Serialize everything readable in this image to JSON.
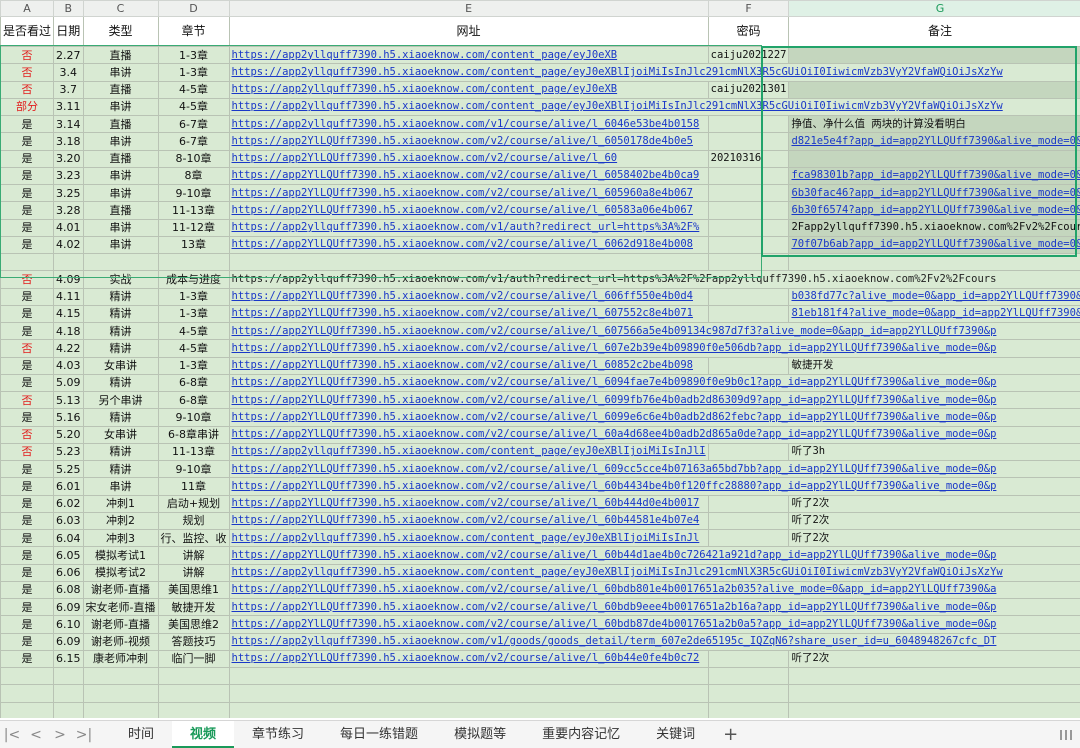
{
  "columns": [
    "A",
    "B",
    "C",
    "D",
    "E",
    "F",
    "G"
  ],
  "headers": [
    "是否看过",
    "日期",
    "类型",
    "章节",
    "网址",
    "密码",
    "备注"
  ],
  "rows": [
    [
      "否",
      "2.27",
      "直播",
      "1-3章",
      "https://app2yllquff7390.h5.xiaoeknow.com/content_page/eyJ0eXB",
      "caiju2021227",
      ""
    ],
    [
      "否",
      "3.4",
      "串讲",
      "1-3章",
      "https://app2yllquff7390.h5.xiaoeknow.com/content_page/eyJ0eXBlIjoiMiIsInJlc291cmNlX3R5cGUiOiI0IiwicmVzb3VyY2VfaWQiOiJsXzYw",
      "",
      ""
    ],
    [
      "否",
      "3.7",
      "直播",
      "4-5章",
      "https://app2yllquff7390.h5.xiaoeknow.com/content_page/eyJ0eXB",
      "caiju2021301",
      ""
    ],
    [
      "部分",
      "3.11",
      "串讲",
      "4-5章",
      "https://app2yllquff7390.h5.xiaoeknow.com/content_page/eyJ0eXBlIjoiMiIsInJlc291cmNlX3R5cGUiOiI0IiwicmVzb3VyY2VfaWQiOiJsXzYw",
      "",
      ""
    ],
    [
      "是",
      "3.14",
      "直播",
      "6-7章",
      "https://app2yllquff7390.h5.xiaoeknow.com/v1/course/alive/l_6046e53be4b0158",
      "",
      "挣值、净什么值   两块的计算没看明白"
    ],
    [
      "是",
      "3.18",
      "串讲",
      "6-7章",
      "https://app2YlLQUff7390.h5.xiaoeknow.com/v2/course/alive/l_6050178de4b0e5",
      "",
      "d821e5e4f?app_id=app2YlLQUff7390&alive_mode=0&p"
    ],
    [
      "是",
      "3.20",
      "直播",
      "8-10章",
      "https://app2YlLQUff7390.h5.xiaoeknow.com/v2/course/alive/l_60",
      "20210316",
      ""
    ],
    [
      "是",
      "3.23",
      "串讲",
      "8章",
      "https://app2YlLQUff7390.h5.xiaoeknow.com/v2/course/alive/l_6058402be4b0ca9",
      "",
      "fca98301b?app_id=app2YlLQUff7390&alive_mode=0&p"
    ],
    [
      "是",
      "3.25",
      "串讲",
      "9-10章",
      "https://app2YlLQUff7390.h5.xiaoeknow.com/v2/course/alive/l_605960a8e4b067",
      "",
      "6b30fac46?app_id=app2YlLQUff7390&alive_mode=0&p"
    ],
    [
      "是",
      "3.28",
      "直播",
      "11-13章",
      "https://app2YlLQUff7390.h5.xiaoeknow.com/v2/course/alive/l_60583a06e4b067",
      "",
      "6b30f6574?app_id=app2YlLQUff7390&alive_mode=0&p"
    ],
    [
      "是",
      "4.01",
      "串讲",
      "11-12章",
      "https://app2yllquff7390.h5.xiaoeknow.com/v1/auth?redirect_url=https%3A%2F%",
      "",
      "2Fapp2yllquff7390.h5.xiaoeknow.com%2Fv2%2Fcours"
    ],
    [
      "是",
      "4.02",
      "串讲",
      "13章",
      "https://app2YlLQUff7390.h5.xiaoeknow.com/v2/course/alive/l_6062d918e4b008",
      "",
      "70f07b6ab?app_id=app2YlLQUff7390&alive_mode=0&p"
    ],
    [
      "",
      "",
      "",
      "",
      "",
      "",
      ""
    ],
    [
      "否",
      "4.09",
      "实战",
      "成本与进度",
      "https://app2yllquff7390.h5.xiaoeknow.com/v1/auth?redirect_url=https%3A%2F%2Fapp2yllquff7390.h5.xiaoeknow.com%2Fv2%2Fcours",
      "",
      ""
    ],
    [
      "是",
      "4.11",
      "精讲",
      "1-3章",
      "https://app2YlLQUff7390.h5.xiaoeknow.com/v2/course/alive/l_606ff550e4b0d4",
      "",
      "b038fd77c?alive_mode=0&app_id=app2YlLQUff7390&p"
    ],
    [
      "是",
      "4.15",
      "精讲",
      "1-3章",
      "https://app2YlLQUff7390.h5.xiaoeknow.com/v2/course/alive/l_607552c8e4b071",
      "",
      "81eb181f4?alive_mode=0&app_id=app2YlLQUff7390&p"
    ],
    [
      "是",
      "4.18",
      "精讲",
      "4-5章",
      "https://app2YlLQUff7390.h5.xiaoeknow.com/v2/course/alive/l_607566a5e4b09134c987d7f3?alive_mode=0&app_id=app2YlLQUff7390&p",
      "",
      ""
    ],
    [
      "否",
      "4.22",
      "精讲",
      "4-5章",
      "https://app2YlLQUff7390.h5.xiaoeknow.com/v2/course/alive/l_607e2b39e4b09890f0e506db?app_id=app2YlLQUff7390&alive_mode=0&p",
      "",
      ""
    ],
    [
      "是",
      "4.03",
      "女串讲",
      "1-3章",
      "https://app2YlLQUff7390.h5.xiaoeknow.com/v2/course/alive/l_60852c2be4b098",
      "",
      "敏捷开发"
    ],
    [
      "是",
      "5.09",
      "精讲",
      "6-8章",
      "https://app2YlLQUff7390.h5.xiaoeknow.com/v2/course/alive/l_6094fae7e4b09890f0e9b0c1?app_id=app2YlLQUff7390&alive_mode=0&p",
      "",
      ""
    ],
    [
      "否",
      "5.13",
      "另个串讲",
      "6-8章",
      "https://app2YlLQUff7390.h5.xiaoeknow.com/v2/course/alive/l_6099fb76e4b0adb2d86309d9?app_id=app2YlLQUff7390&alive_mode=0&p",
      "",
      ""
    ],
    [
      "是",
      "5.16",
      "精讲",
      "9-10章",
      "https://app2YlLQUff7390.h5.xiaoeknow.com/v2/course/alive/l_6099e6c6e4b0adb2d862febc?app_id=app2YlLQUff7390&alive_mode=0&p",
      "",
      ""
    ],
    [
      "否",
      "5.20",
      "女串讲",
      "6-8章串讲",
      "https://app2YlLQUff7390.h5.xiaoeknow.com/v2/course/alive/l_60a4d68ee4b0adb2d865a0de?app_id=app2YlLQUff7390&alive_mode=0&p",
      "",
      ""
    ],
    [
      "否",
      "5.23",
      "精讲",
      "11-13章",
      "https://app2yllquff7390.h5.xiaoeknow.com/content_page/eyJ0eXBlIjoiMiIsInJlI",
      "",
      "听了3h"
    ],
    [
      "是",
      "5.25",
      "精讲",
      "9-10章",
      "https://app2YlLQUff7390.h5.xiaoeknow.com/v2/course/alive/l_609cc5cce4b07163a65bd7bb?app_id=app2YlLQUff7390&alive_mode=0&p",
      "",
      ""
    ],
    [
      "是",
      "6.01",
      "串讲",
      "11章",
      "https://app2YlLQUff7390.h5.xiaoeknow.com/v2/course/alive/l_60b4434be4b0f120ffc28880?app_id=app2YlLQUff7390&alive_mode=0&p",
      "",
      ""
    ],
    [
      "是",
      "6.02",
      "冲刺1",
      "启动+规划",
      "https://app2YlLQUff7390.h5.xiaoeknow.com/v2/course/alive/l_60b444d0e4b0017",
      "",
      "听了2次"
    ],
    [
      "是",
      "6.03",
      "冲刺2",
      "规划",
      "https://app2YlLQUff7390.h5.xiaoeknow.com/v2/course/alive/l_60b44581e4b07e4",
      "",
      "听了2次"
    ],
    [
      "是",
      "6.04",
      "冲刺3",
      "行、监控、收",
      "https://app2yllquff7390.h5.xiaoeknow.com/content_page/eyJ0eXBlIjoiMiIsInJl",
      "",
      "听了2次"
    ],
    [
      "是",
      "6.05",
      "模拟考试1",
      "讲解",
      "https://app2YlLQUff7390.h5.xiaoeknow.com/v2/course/alive/l_60b44d1ae4b0c726421a921d?app_id=app2YlLQUff7390&alive_mode=0&p",
      "",
      ""
    ],
    [
      "是",
      "6.06",
      "模拟考试2",
      "讲解",
      "https://app2yllquff7390.h5.xiaoeknow.com/content_page/eyJ0eXBlIjoiMiIsInJlc291cmNlX3R5cGUiOiI0IiwicmVzb3VyY2VfaWQiOiJsXzYw",
      "",
      ""
    ],
    [
      "是",
      "6.08",
      "谢老师-直播",
      "美国思维1",
      "https://app2YlLQUff7390.h5.xiaoeknow.com/v2/course/alive/l_60bdb801e4b0017651a2b035?alive_mode=0&app_id=app2YlLQUff7390&a",
      "",
      ""
    ],
    [
      "是",
      "6.09",
      "宋女老师-直播",
      "敏捷开发",
      "https://app2YlLQUff7390.h5.xiaoeknow.com/v2/course/alive/l_60bdb9eee4b0017651a2b16a?app_id=app2YlLQUff7390&alive_mode=0&p",
      "",
      ""
    ],
    [
      "是",
      "6.10",
      "谢老师-直播",
      "美国思维2",
      "https://app2YlLQUff7390.h5.xiaoeknow.com/v2/course/alive/l_60bdb87de4b0017651a2b0a5?app_id=app2YlLQUff7390&alive_mode=0&p",
      "",
      ""
    ],
    [
      "是",
      "6.09",
      "谢老师-视频",
      "答题技巧",
      "https://app2yllquff7390.h5.xiaoeknow.com/v1/goods/goods_detail/term_607e2de65195c_IQZqN6?share_user_id=u_6048948267cfc_DT",
      "",
      ""
    ],
    [
      "是",
      "6.15",
      "康老师冲刺",
      "临门一脚",
      "https://app2YlLQUff7390.h5.xiaoeknow.com/v2/course/alive/l_60b44e0fe4b0c72",
      "",
      "听了2次"
    ]
  ],
  "tabs": [
    "时间",
    "视频",
    "章节练习",
    "每日一练错题",
    "模拟题等",
    "重要内容记忆",
    "关键词"
  ],
  "active_tab": "视频",
  "nav": [
    "|<",
    "<",
    ">",
    ">|"
  ],
  "add_tab": "+",
  "colors": {
    "cell_bg": "#d9ead3",
    "red_text": "#e21b1b",
    "link": "#1a38c8",
    "accent": "#1a9a5a"
  }
}
